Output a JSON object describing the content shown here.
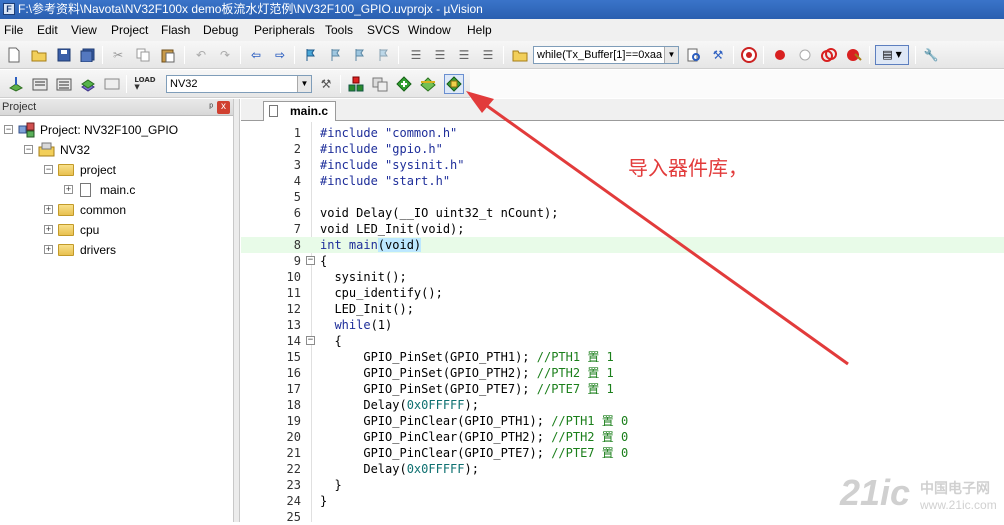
{
  "window": {
    "title": "F:\\参考资料\\Navota\\NV32F100x demo板流水灯范例\\NV32F100_GPIO.uvprojx - µVision"
  },
  "menu": [
    "File",
    "Edit",
    "View",
    "Project",
    "Flash",
    "Debug",
    "Peripherals",
    "Tools",
    "SVCS",
    "Window",
    "Help"
  ],
  "toolbar": {
    "find_combo": "while(Tx_Buffer[1]==0xaa",
    "target_combo": "NV32"
  },
  "project_panel": {
    "title": "Project",
    "pin": "ᵖ",
    "close": "x",
    "tree": [
      {
        "label": "Project: NV32F100_GPIO"
      },
      {
        "label": "NV32"
      },
      {
        "label": "project"
      },
      {
        "label": "main.c"
      },
      {
        "label": "common"
      },
      {
        "label": "cpu"
      },
      {
        "label": "drivers"
      }
    ]
  },
  "editor": {
    "tab": "main.c",
    "highlight_line": 8,
    "lines": [
      {
        "n": "1"
      },
      {
        "n": "2"
      },
      {
        "n": "3"
      },
      {
        "n": "4"
      },
      {
        "n": "5"
      },
      {
        "n": "6"
      },
      {
        "n": "7"
      },
      {
        "n": "8"
      },
      {
        "n": "9"
      },
      {
        "n": "10"
      },
      {
        "n": "11"
      },
      {
        "n": "12"
      },
      {
        "n": "13"
      },
      {
        "n": "14"
      },
      {
        "n": "15"
      },
      {
        "n": "16"
      },
      {
        "n": "17"
      },
      {
        "n": "18"
      },
      {
        "n": "19"
      },
      {
        "n": "20"
      },
      {
        "n": "21"
      },
      {
        "n": "22"
      },
      {
        "n": "23"
      },
      {
        "n": "24"
      },
      {
        "n": "25"
      }
    ],
    "code": {
      "l1": "#include \"common.h\"",
      "l2": "#include \"gpio.h\"",
      "l3": "#include \"sysinit.h\"",
      "l4": "#include \"start.h\"",
      "l6": "void Delay(__IO uint32_t nCount);",
      "l7": "void LED_Init(void);",
      "l8a": "int main",
      "l8b": "(void)",
      "l9": "{",
      "l10": "  sysinit();",
      "l11": "  cpu_identify();",
      "l12": "  LED_Init();",
      "l13a": "  while",
      "l13b": "(1)",
      "l14": "  {",
      "l15a": "      GPIO_PinSet(GPIO_PTH1); ",
      "l15b": "//PTH1 置 1",
      "l16a": "      GPIO_PinSet(GPIO_PTH2); ",
      "l16b": "//PTH2 置 1",
      "l17a": "      GPIO_PinSet(GPIO_PTE7); ",
      "l17b": "//PTE7 置 1",
      "l18a": "      Delay(",
      "l18b": "0x0FFFFF",
      "l18c": ");",
      "l19a": "      GPIO_PinClear(GPIO_PTH1); ",
      "l19b": "//PTH1 置 0",
      "l20a": "      GPIO_PinClear(GPIO_PTH2); ",
      "l20b": "//PTH2 置 0",
      "l21a": "      GPIO_PinClear(GPIO_PTE7); ",
      "l21b": "//PTE7 置 0",
      "l22a": "      Delay(",
      "l22b": "0x0FFFFF",
      "l22c": ");",
      "l23": "  }",
      "l24": "}"
    }
  },
  "annotation": {
    "text": "导入器件库，",
    "color": "#e23b3b"
  },
  "watermark": {
    "big": "21ic",
    "small": "中国电子网",
    "url": "www.21ic.com"
  }
}
